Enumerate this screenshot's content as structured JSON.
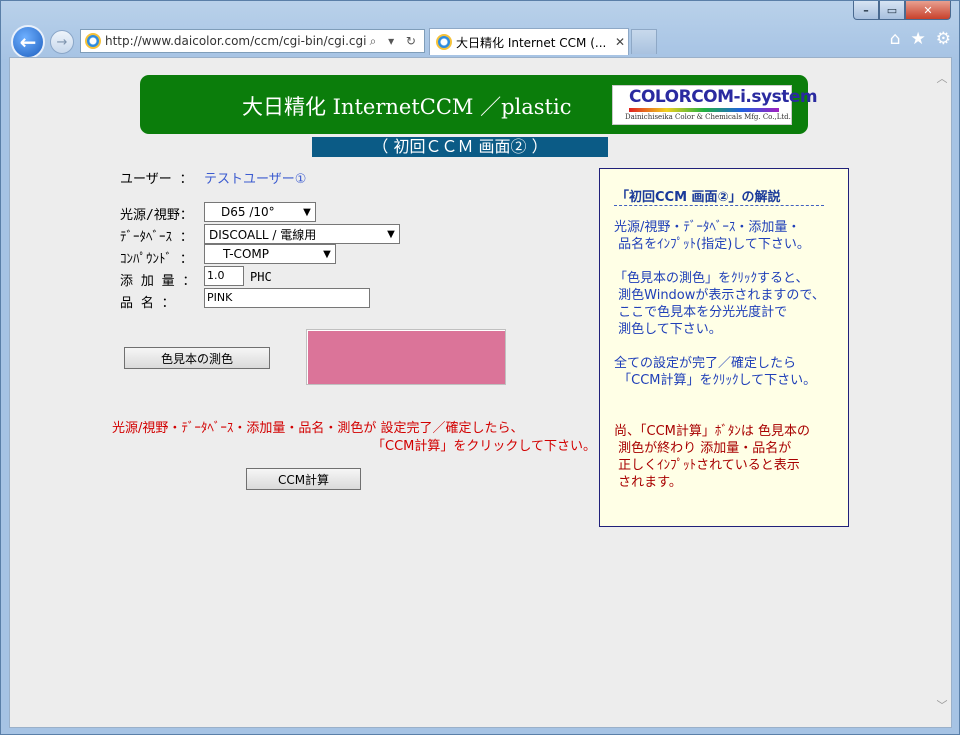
{
  "browser": {
    "url": "http://www.daicolor.com/ccm/cgi-bin/cgi.cgi",
    "tab_title": "大日精化 Internet CCM (...",
    "tab_close": "✕",
    "back": "←",
    "forward": "→",
    "addr_tools": "⌕ ▾ ↻",
    "home_icon": "⌂",
    "fav_icon": "★",
    "gear_icon": "⚙",
    "min_label": "–",
    "max_label": "▭",
    "close_label": "✕"
  },
  "banner": {
    "title": "大日精化 InternetCCM ／plastic",
    "logo_main": "COLORCOM-i.system",
    "logo_sub": "Dainichiseika Color & Chemicals Mfg. Co.,Ltd."
  },
  "subtitle": "（ 初回ＣＣＭ 画面② ）",
  "form": {
    "user_label": "ユーザー ：",
    "user_value": "テストユーザー①",
    "light_label": "光源/視野：",
    "light_value": "D65 /10°",
    "db_label": "ﾃﾞｰﾀﾍﾞｰｽ ：",
    "db_value": "DISCOALL     / 電線用",
    "compound_label": "ｺﾝﾊﾟｳﾝﾄﾞ ：",
    "compound_value": "T-COMP",
    "amount_label": "添 加 量 ：",
    "amount_value": "1.0",
    "amount_unit": "PHC",
    "name_label": "品  名 ：",
    "name_value": "PINK",
    "measure_button": "色見本の測色",
    "calc_button": "CCM計算",
    "swatch_color": "#db7499"
  },
  "warning": {
    "line1": "光源/視野・ﾃﾞｰﾀﾍﾞｰｽ・添加量・品名・測色が 設定完了／確定したら、",
    "line2": "「CCM計算」をクリックして下さい。"
  },
  "help": {
    "title": "「初回CCM 画面②」の解説",
    "p1": "光源/視野・ﾃﾞｰﾀﾍﾞｰｽ・添加量・\n 品名をｲﾝﾌﾟｯﾄ(指定)して下さい。",
    "p2": "「色見本の測色」をｸﾘｯｸすると、\n 測色Windowが表示されますので、\n ここで色見本を分光光度計で\n 測色して下さい。",
    "p3": "全ての設定が完了／確定したら\n 「CCM計算」をｸﾘｯｸして下さい。",
    "p4": "尚、「CCM計算」ﾎﾞﾀﾝは 色見本の\n 測色が終わり 添加量・品名が\n 正しくｲﾝﾌﾟｯﾄされていると表示\n されます。"
  }
}
